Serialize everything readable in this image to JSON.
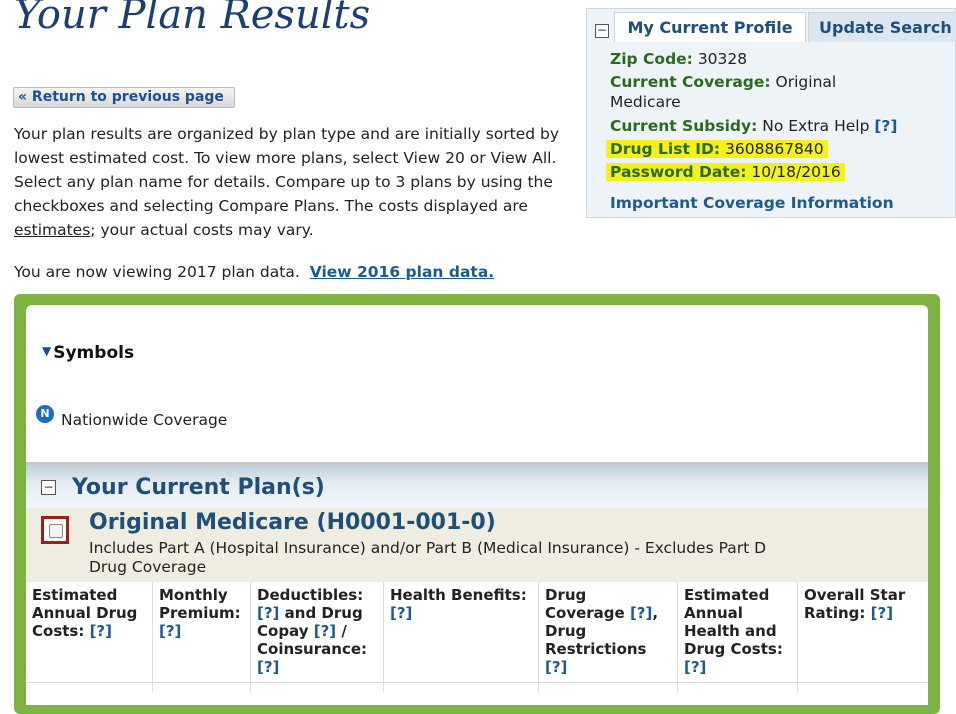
{
  "page": {
    "title": "Your Plan Results",
    "return_label": "« Return to previous page",
    "intro_part1": "Your plan results are organized by plan type and are initially sorted by lowest estimated cost. To view more plans, select View 20 or View All. Select any plan name for details. Compare up to 3 plans by using the checkboxes and selecting Compare Plans. The costs displayed are ",
    "intro_link": "estimates",
    "intro_part2": "; your actual costs may vary.",
    "viewing_text": "You are now viewing 2017 plan data.",
    "viewing_link": "View 2016 plan data."
  },
  "profile": {
    "toggle": "−",
    "tab_current": "My Current Profile",
    "tab_update": "Update Search",
    "zip_label": "Zip Code:",
    "zip_value": "30328",
    "coverage_label": "Current Coverage:",
    "coverage_value_1": "Original",
    "coverage_value_2": "Medicare",
    "subsidy_label": "Current Subsidy:",
    "subsidy_value": "No Extra Help",
    "help": "[?]",
    "druglist_label": "Drug List ID:",
    "druglist_value": "3608867840",
    "password_label": "Password Date:",
    "password_value": "10/18/2016",
    "important_link": "Important Coverage Information"
  },
  "symbols": {
    "title": "Symbols",
    "n_icon": "N",
    "nationwide": "Nationwide Coverage"
  },
  "section": {
    "toggle": "−",
    "title": "Your Current Plan(s)"
  },
  "plan": {
    "name": "Original Medicare (H0001-001-0)",
    "desc": "Includes Part A (Hospital Insurance) and/or Part B (Medical Insurance) - Excludes Part D Drug Coverage"
  },
  "table": {
    "help": "[?]",
    "c1": "Estimated Annual Drug Costs:",
    "c2": "Monthly Premium:",
    "c3a": "Deductibles:",
    "c3b": "and Drug Copay",
    "c3c": "/ Coinsurance:",
    "c4": "Health Benefits:",
    "c5a": "Drug Coverage",
    "c5b": ", Drug Restrictions",
    "c6": "Estimated Annual Health and Drug Costs:",
    "c7": "Overall Star Rating:"
  },
  "colors": {
    "green_frame": "#7cb342",
    "title_blue": "#1d3f70",
    "highlight": "#f4f11a",
    "label_green": "#2b6a1e"
  }
}
